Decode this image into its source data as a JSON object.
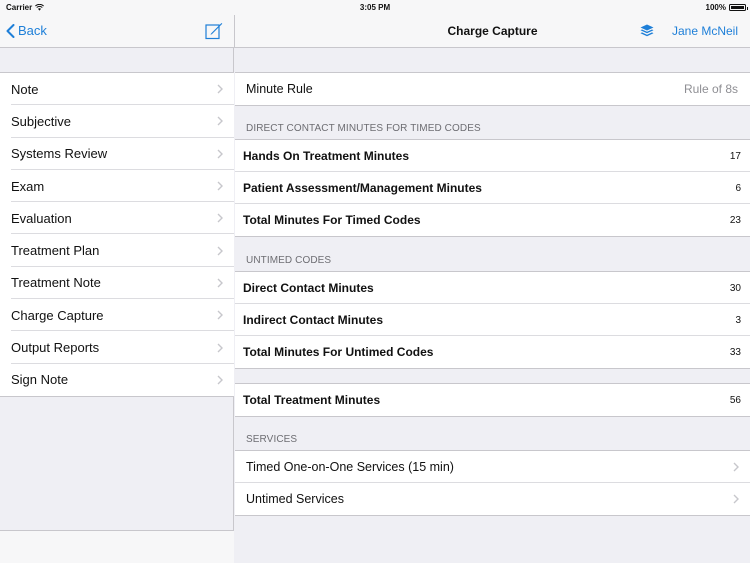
{
  "status_bar": {
    "carrier": "Carrier",
    "time": "3:05 PM",
    "battery": "100%"
  },
  "nav": {
    "back_label": "Back",
    "title": "Charge Capture",
    "user_label": "Jane McNeil",
    "accent_color": "#1e7fd8",
    "icons": [
      "chevron-left-icon",
      "compose-icon",
      "layers-icon"
    ]
  },
  "sidebar": {
    "items": [
      {
        "label": "Note"
      },
      {
        "label": "Subjective"
      },
      {
        "label": "Systems Review"
      },
      {
        "label": "Exam"
      },
      {
        "label": "Evaluation"
      },
      {
        "label": "Treatment Plan"
      },
      {
        "label": "Treatment Note"
      },
      {
        "label": "Charge Capture"
      },
      {
        "label": "Output Reports"
      },
      {
        "label": "Sign Note"
      }
    ]
  },
  "main": {
    "minute_rule": {
      "label": "Minute Rule",
      "value": "Rule of 8s"
    },
    "timed": {
      "header": "DIRECT CONTACT MINUTES FOR TIMED CODES",
      "rows": [
        {
          "label": "Hands On Treatment Minutes",
          "value": "17"
        },
        {
          "label": "Patient Assessment/Management Minutes",
          "value": "6"
        },
        {
          "label": "Total Minutes For Timed Codes",
          "value": "23"
        }
      ]
    },
    "untimed": {
      "header": "UNTIMED CODES",
      "rows": [
        {
          "label": "Direct Contact Minutes",
          "value": "30"
        },
        {
          "label": "Indirect Contact Minutes",
          "value": "3"
        },
        {
          "label": "Total Minutes For Untimed Codes",
          "value": "33"
        }
      ]
    },
    "total": {
      "label": "Total Treatment Minutes",
      "value": "56"
    },
    "services": {
      "header": "SERVICES",
      "rows": [
        {
          "label": "Timed One-on-One Services (15 min)"
        },
        {
          "label": "Untimed Services"
        }
      ]
    }
  }
}
